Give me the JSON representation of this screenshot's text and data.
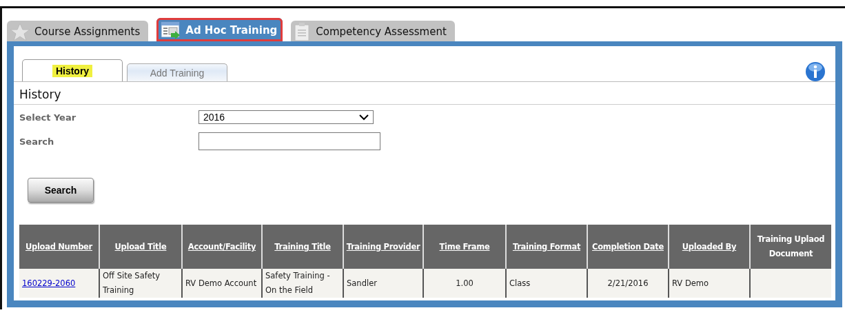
{
  "main_tabs": [
    {
      "label": "Course Assignments",
      "selected": false,
      "highlighted": false
    },
    {
      "label": "Ad Hoc Training",
      "selected": true,
      "highlighted": true
    },
    {
      "label": "Competency Assessment",
      "selected": false,
      "highlighted": false
    }
  ],
  "sub_tabs": [
    {
      "label": "History",
      "selected": true,
      "highlighted": true
    },
    {
      "label": "Add Training",
      "selected": false,
      "highlighted": false
    }
  ],
  "section_title": "History",
  "form": {
    "year_label": "Select Year",
    "year_value": "2016",
    "search_label": "Search",
    "search_button": "Search"
  },
  "table": {
    "columns": [
      {
        "label": "Upload Number",
        "sortable": true
      },
      {
        "label": "Upload Title",
        "sortable": true
      },
      {
        "label": "Account/Facility",
        "sortable": true
      },
      {
        "label": "Training Title",
        "sortable": true
      },
      {
        "label": "Training Provider",
        "sortable": true
      },
      {
        "label": "Time Frame",
        "sortable": true
      },
      {
        "label": "Training Format",
        "sortable": true
      },
      {
        "label": "Completion Date",
        "sortable": true
      },
      {
        "label": "Uploaded By",
        "sortable": true
      },
      {
        "label": "Training Uplaod Document",
        "sortable": false
      }
    ],
    "rows": [
      {
        "cells": [
          {
            "text": "160229-2060",
            "kind": "link"
          },
          {
            "text": "Off Site Safety Training",
            "kind": "text"
          },
          {
            "text": "RV Demo Account",
            "kind": "text"
          },
          {
            "text": "Safety Training - On the Field",
            "kind": "text"
          },
          {
            "text": "Sandler",
            "kind": "text"
          },
          {
            "text": "1.00",
            "kind": "center"
          },
          {
            "text": "Class",
            "kind": "text"
          },
          {
            "text": "2/21/2016",
            "kind": "center"
          },
          {
            "text": "RV Demo",
            "kind": "text"
          },
          {
            "text": "",
            "kind": "text"
          }
        ]
      }
    ]
  }
}
